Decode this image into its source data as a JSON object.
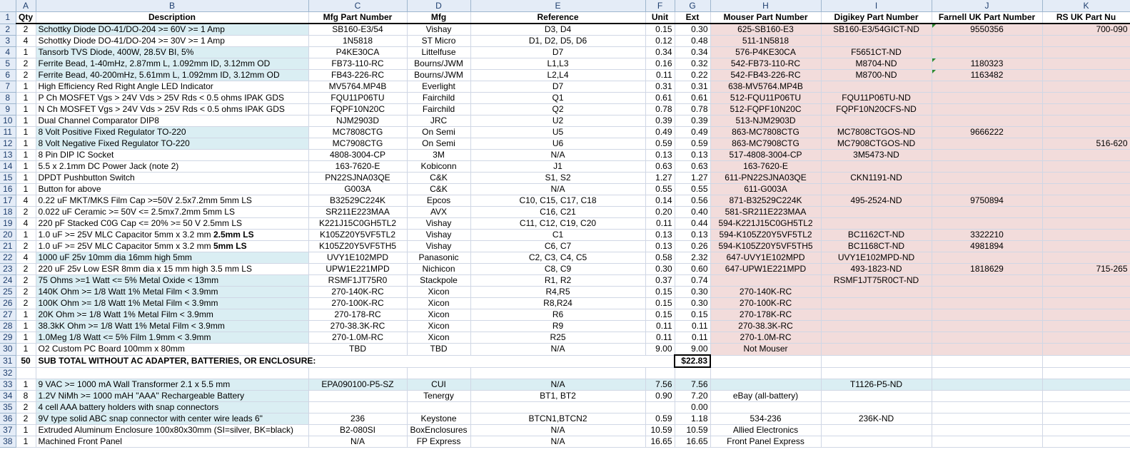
{
  "columns": [
    "A",
    "B",
    "C",
    "D",
    "E",
    "F",
    "G",
    "H",
    "I",
    "J",
    "K"
  ],
  "header_row": {
    "qty": "Qty",
    "description": "Description",
    "mfg_pn": "Mfg Part Number",
    "mfg": "Mfg",
    "reference": "Reference",
    "unit": "Unit",
    "ext": "Ext",
    "mouser": "Mouser Part Number",
    "digikey": "Digikey Part Number",
    "farnell": "Farnell UK Part Number",
    "rs": "RS UK Part Nu"
  },
  "rows": [
    {
      "n": "2",
      "qty": "2",
      "desc": "Schottky Diode DO-41/DO-204 >= 60V  >= 1 Amp",
      "mpn": "SB160-E3/54",
      "mfg": "Vishay",
      "ref": "D3, D4",
      "unit": "0.15",
      "ext": "0.30",
      "mouser": "625-SB160-E3",
      "digikey": "SB160-E3/54GICT-ND",
      "farnell": "9550356",
      "rs": "700-090",
      "hl": true
    },
    {
      "n": "3",
      "qty": "4",
      "desc": "Schottky Diode DO-41/DO-204 >= 30V >= 1 Amp",
      "mpn": "1N5818",
      "mfg": "ST Micro",
      "ref": "D1, D2, D5, D6",
      "unit": "0.12",
      "ext": "0.48",
      "mouser": "511-1N5818",
      "digikey": "",
      "farnell": "",
      "rs": "",
      "hl": false
    },
    {
      "n": "4",
      "qty": "1",
      "desc": "Tansorb TVS Diode, 400W, 28.5V BI, 5%",
      "mpn": "P4KE30CA",
      "mfg": "Littelfuse",
      "ref": "D7",
      "unit": "0.34",
      "ext": "0.34",
      "mouser": "576-P4KE30CA",
      "digikey": "F5651CT-ND",
      "farnell": "",
      "rs": "",
      "hl": true
    },
    {
      "n": "5",
      "qty": "2",
      "desc": "Ferrite Bead, 1-40mHz, 2.87mm L, 1.092mm ID, 3.12mm OD",
      "mpn": "FB73-110-RC",
      "mfg": "Bourns/JWM",
      "ref": "L1,L3",
      "unit": "0.16",
      "ext": "0.32",
      "mouser": "542-FB73-110-RC",
      "digikey": "M8704-ND",
      "farnell": "1180323",
      "rs": "",
      "hl": true
    },
    {
      "n": "6",
      "qty": "2",
      "desc": "Ferrite Bead, 40-200mHz, 5.61mm L, 1.092mm ID, 3.12mm OD",
      "mpn": "FB43-226-RC",
      "mfg": "Bourns/JWM",
      "ref": "L2,L4",
      "unit": "0.11",
      "ext": "0.22",
      "mouser": "542-FB43-226-RC",
      "digikey": "M8700-ND",
      "farnell": "1163482",
      "rs": "",
      "hl": true
    },
    {
      "n": "7",
      "qty": "1",
      "desc": "High Efficiency Red Right Angle LED Indicator",
      "mpn": "MV5764.MP4B",
      "mfg": "Everlight",
      "ref": "D7",
      "unit": "0.31",
      "ext": "0.31",
      "mouser": "638-MV5764.MP4B",
      "digikey": "",
      "farnell": "",
      "rs": "",
      "hl": false
    },
    {
      "n": "8",
      "qty": "1",
      "desc": "P Ch MOSFET Vgs > 24V Vds > 25V Rds < 0.5 ohms IPAK GDS",
      "mpn": "FQU11P06TU",
      "mfg": "Fairchild",
      "ref": "Q1",
      "unit": "0.61",
      "ext": "0.61",
      "mouser": "512-FQU11P06TU",
      "digikey": "FQU11P06TU-ND",
      "farnell": "",
      "rs": "",
      "hl": false
    },
    {
      "n": "9",
      "qty": "1",
      "desc": "N Ch MOSFET Vgs > 24V Vds > 25V Rds < 0.5 ohms IPAK GDS",
      "mpn": "FQPF10N20C",
      "mfg": "Fairchild",
      "ref": "Q2",
      "unit": "0.78",
      "ext": "0.78",
      "mouser": "512-FQPF10N20C",
      "digikey": "FQPF10N20CFS-ND",
      "farnell": "",
      "rs": "",
      "hl": false
    },
    {
      "n": "10",
      "qty": "1",
      "desc": "Dual Channel Comparator DIP8",
      "mpn": "NJM2903D",
      "mfg": "JRC",
      "ref": "U2",
      "unit": "0.39",
      "ext": "0.39",
      "mouser": "513-NJM2903D",
      "digikey": "",
      "farnell": "",
      "rs": "",
      "hl": false
    },
    {
      "n": "11",
      "qty": "1",
      "desc": "8 Volt Positive Fixed Regulator TO-220",
      "mpn": "MC7808CTG",
      "mfg": "On Semi",
      "ref": "U5",
      "unit": "0.49",
      "ext": "0.49",
      "mouser": "863-MC7808CTG",
      "digikey": "MC7808CTGOS-ND",
      "farnell": "9666222",
      "rs": "",
      "hl": true
    },
    {
      "n": "12",
      "qty": "1",
      "desc": "8 Volt Negative Fixed Regulator TO-220",
      "mpn": "MC7908CTG",
      "mfg": "On Semi",
      "ref": "U6",
      "unit": "0.59",
      "ext": "0.59",
      "mouser": "863-MC7908CTG",
      "digikey": "MC7908CTGOS-ND",
      "farnell": "",
      "rs": "516-620",
      "hl": true
    },
    {
      "n": "13",
      "qty": "1",
      "desc": "8 Pin DIP IC Socket",
      "mpn": "4808-3004-CP",
      "mfg": "3M",
      "ref": "N/A",
      "unit": "0.13",
      "ext": "0.13",
      "mouser": "517-4808-3004-CP",
      "digikey": "3M5473-ND",
      "farnell": "",
      "rs": "",
      "hl": false
    },
    {
      "n": "14",
      "qty": "1",
      "desc": "5.5 x 2.1mm DC Power Jack (note 2)",
      "mpn": "163-7620-E",
      "mfg": "Kobiconn",
      "ref": "J1",
      "unit": "0.63",
      "ext": "0.63",
      "mouser": "163-7620-E",
      "digikey": "",
      "farnell": "",
      "rs": "",
      "hl": false
    },
    {
      "n": "15",
      "qty": "1",
      "desc": "DPDT Pushbutton Switch",
      "mpn": "PN22SJNA03QE",
      "mfg": "C&K",
      "ref": "S1, S2",
      "unit": "1.27",
      "ext": "1.27",
      "mouser": "611-PN22SJNA03QE",
      "digikey": "CKN1191-ND",
      "farnell": "",
      "rs": "",
      "hl": false
    },
    {
      "n": "16",
      "qty": "1",
      "desc": "Button for above",
      "mpn": "G003A",
      "mfg": "C&K",
      "ref": "N/A",
      "unit": "0.55",
      "ext": "0.55",
      "mouser": "611-G003A",
      "digikey": "",
      "farnell": "",
      "rs": "",
      "hl": false
    },
    {
      "n": "17",
      "qty": "4",
      "desc": "0.22 uF MKT/MKS Film Cap >=50V 2.5x7.2mm 5mm LS",
      "mpn": "B32529C224K",
      "mfg": "Epcos",
      "ref": "C10, C15, C17, C18",
      "unit": "0.14",
      "ext": "0.56",
      "mouser": "871-B32529C224K",
      "digikey": "495-2524-ND",
      "farnell": "9750894",
      "rs": "",
      "hl": false
    },
    {
      "n": "18",
      "qty": "2",
      "desc": "0.022 uF Ceramic >= 50V <= 2.5mx7.2mm 5mm LS",
      "mpn": "SR211E223MAA",
      "mfg": "AVX",
      "ref": "C16, C21",
      "unit": "0.20",
      "ext": "0.40",
      "mouser": "581-SR211E223MAA",
      "digikey": "",
      "farnell": "",
      "rs": "",
      "hl": false
    },
    {
      "n": "19",
      "qty": "4",
      "desc": "220 pF Stacked C0G Cap <= 20% >= 50 V 2.5mm LS",
      "mpn": "K221J15C0GH5TL2",
      "mfg": "Vishay",
      "ref": "C11, C12, C19, C20",
      "unit": "0.11",
      "ext": "0.44",
      "mouser": "594-K221J15C0GH5TL2",
      "digikey": "",
      "farnell": "",
      "rs": "",
      "hl": false
    },
    {
      "n": "20",
      "qty": "1",
      "desc": "1.0 uF >= 25V MLC Capacitor 5mm x 3.2 mm ",
      "desc_bold": "2.5mm LS",
      "mpn": "K105Z20Y5VF5TL2",
      "mfg": "Vishay",
      "ref": "C1",
      "unit": "0.13",
      "ext": "0.13",
      "mouser": "594-K105Z20Y5VF5TL2",
      "digikey": "BC1162CT-ND",
      "farnell": "3322210",
      "rs": "",
      "hl": false
    },
    {
      "n": "21",
      "qty": "2",
      "desc": "1.0 uF >= 25V MLC Capacitor 5mm x 3.2 mm ",
      "desc_bold": "5mm LS",
      "mpn": "K105Z20Y5VF5TH5",
      "mfg": "Vishay",
      "ref": "C6, C7",
      "unit": "0.13",
      "ext": "0.26",
      "mouser": "594-K105Z20Y5VF5TH5",
      "digikey": "BC1168CT-ND",
      "farnell": "4981894",
      "rs": "",
      "hl": false
    },
    {
      "n": "22",
      "qty": "4",
      "desc": "1000 uF 25v 10mm dia 16mm high 5mm",
      "mpn": "UVY1E102MPD",
      "mfg": "Panasonic",
      "ref": "C2, C3, C4, C5",
      "unit": "0.58",
      "ext": "2.32",
      "mouser": "647-UVY1E102MPD",
      "digikey": "UVY1E102MPD-ND",
      "farnell": "",
      "rs": "",
      "hl": true
    },
    {
      "n": "23",
      "qty": "2",
      "desc": "220 uF 25v Low ESR 8mm dia x 15 mm high 3.5 mm LS",
      "mpn": "UPW1E221MPD",
      "mfg": "Nichicon",
      "ref": "C8, C9",
      "unit": "0.30",
      "ext": "0.60",
      "mouser": "647-UPW1E221MPD",
      "digikey": "493-1823-ND",
      "farnell": "1818629",
      "rs": "715-265",
      "hl": false
    },
    {
      "n": "24",
      "qty": "2",
      "desc": "75 Ohms >=1 Watt <= 5% Metal Oxide < 13mm",
      "mpn": "RSMF1JT75R0",
      "mfg": "Stackpole",
      "ref": "R1, R2",
      "unit": "0.37",
      "ext": "0.74",
      "mouser": "",
      "digikey": "RSMF1JT75R0CT-ND",
      "farnell": "",
      "rs": "",
      "hl": true
    },
    {
      "n": "25",
      "qty": "2",
      "desc": "140K Ohm >= 1/8 Watt 1% Metal Film < 3.9mm",
      "mpn": "270-140K-RC",
      "mfg": "Xicon",
      "ref": "R4,R5",
      "unit": "0.15",
      "ext": "0.30",
      "mouser": "270-140K-RC",
      "digikey": "",
      "farnell": "",
      "rs": "",
      "hl": true
    },
    {
      "n": "26",
      "qty": "2",
      "desc": "100K Ohm >= 1/8 Watt 1% Metal Film < 3.9mm",
      "mpn": "270-100K-RC",
      "mfg": "Xicon",
      "ref": "R8,R24",
      "unit": "0.15",
      "ext": "0.30",
      "mouser": "270-100K-RC",
      "digikey": "",
      "farnell": "",
      "rs": "",
      "hl": true
    },
    {
      "n": "27",
      "qty": "1",
      "desc": "20K Ohm >= 1/8 Watt 1% Metal Film < 3.9mm",
      "mpn": "270-178-RC",
      "mfg": "Xicon",
      "ref": "R6",
      "unit": "0.15",
      "ext": "0.15",
      "mouser": "270-178K-RC",
      "digikey": "",
      "farnell": "",
      "rs": "",
      "hl": true
    },
    {
      "n": "28",
      "qty": "1",
      "desc": "38.3kK Ohm >= 1/8 Watt 1% Metal Film < 3.9mm",
      "mpn": "270-38.3K-RC",
      "mfg": "Xicon",
      "ref": "R9",
      "unit": "0.11",
      "ext": "0.11",
      "mouser": "270-38.3K-RC",
      "digikey": "",
      "farnell": "",
      "rs": "",
      "hl": true
    },
    {
      "n": "29",
      "qty": "1",
      "desc": "1.0Meg 1/8 Watt <= 5% Film 1.9mm < 3.9mm",
      "mpn": "270-1.0M-RC",
      "mfg": "Xicon",
      "ref": "R25",
      "unit": "0.11",
      "ext": "0.11",
      "mouser": "270-1.0M-RC",
      "digikey": "",
      "farnell": "",
      "rs": "",
      "hl": true
    },
    {
      "n": "30",
      "qty": "1",
      "desc": "O2 Custom PC Board 100mm x 80mm",
      "mpn": "TBD",
      "mfg": "TBD",
      "ref": "N/A",
      "unit": "9.00",
      "ext": "9.00",
      "mouser": "Not Mouser",
      "digikey": "",
      "farnell": "",
      "rs": "",
      "hl": false
    }
  ],
  "subtotal": {
    "n": "31",
    "qty": "50",
    "label": "SUB TOTAL WITHOUT AC ADAPTER, BATTERIES, OR ENCLOSURE:",
    "total": "$22.83"
  },
  "blank_row": {
    "n": "32"
  },
  "extra_rows": [
    {
      "n": "33",
      "qty": "1",
      "desc": "9 VAC >= 1000 mA Wall Transformer 2.1 x 5.5 mm",
      "mpn": "EPA090100-P5-SZ",
      "mfg": "CUI",
      "ref": "N/A",
      "unit": "7.56",
      "ext": "7.56",
      "mouser": "",
      "digikey": "T1126-P5-ND",
      "farnell": "",
      "rs": "",
      "hl": true
    },
    {
      "n": "34",
      "qty": "8",
      "desc": "1.2V NiMh >= 1000 mAH \"AAA\" Rechargeable Battery",
      "mpn": "",
      "mfg": "Tenergy",
      "ref": "BT1, BT2",
      "unit": "0.90",
      "ext": "7.20",
      "mouser": "eBay (all-battery)",
      "digikey": "",
      "farnell": "",
      "rs": "",
      "hl": true
    },
    {
      "n": "35",
      "qty": "2",
      "desc": "4 cell AAA battery holders with snap connectors",
      "mpn": "",
      "mfg": "",
      "ref": "",
      "unit": "",
      "ext": "0.00",
      "mouser": "",
      "digikey": "",
      "farnell": "",
      "rs": "",
      "hl": true
    },
    {
      "n": "36",
      "qty": "2",
      "desc": "9V type solid ABC snap connector with center wire leads 6\"",
      "mpn": "236",
      "mfg": "Keystone",
      "ref": "BTCN1,BTCN2",
      "unit": "0.59",
      "ext": "1.18",
      "mouser": "534-236",
      "digikey": "236K-ND",
      "farnell": "",
      "rs": "",
      "hl": true
    },
    {
      "n": "37",
      "qty": "1",
      "desc": "Extruded Aluminum Enclosure 100x80x30mm (SI=silver, BK=black)",
      "mpn": "B2-080SI",
      "mfg": "BoxEnclosures",
      "ref": "N/A",
      "unit": "10.59",
      "ext": "10.59",
      "mouser": "Allied Electronics",
      "digikey": "",
      "farnell": "",
      "rs": "",
      "hl": false
    },
    {
      "n": "38",
      "qty": "1",
      "desc": "Machined Front Panel",
      "mpn": "N/A",
      "mfg": "FP Express",
      "ref": "N/A",
      "unit": "16.65",
      "ext": "16.65",
      "mouser": "Front Panel Express",
      "digikey": "",
      "farnell": "",
      "rs": "",
      "hl": false
    }
  ],
  "colors": {
    "highlight_blue": "#daeef3",
    "highlight_pink": "#f2dcdb",
    "header_bg": "#e4ecf7",
    "grid": "#d0d7e5",
    "comment_marker": "#2e8b2e"
  }
}
